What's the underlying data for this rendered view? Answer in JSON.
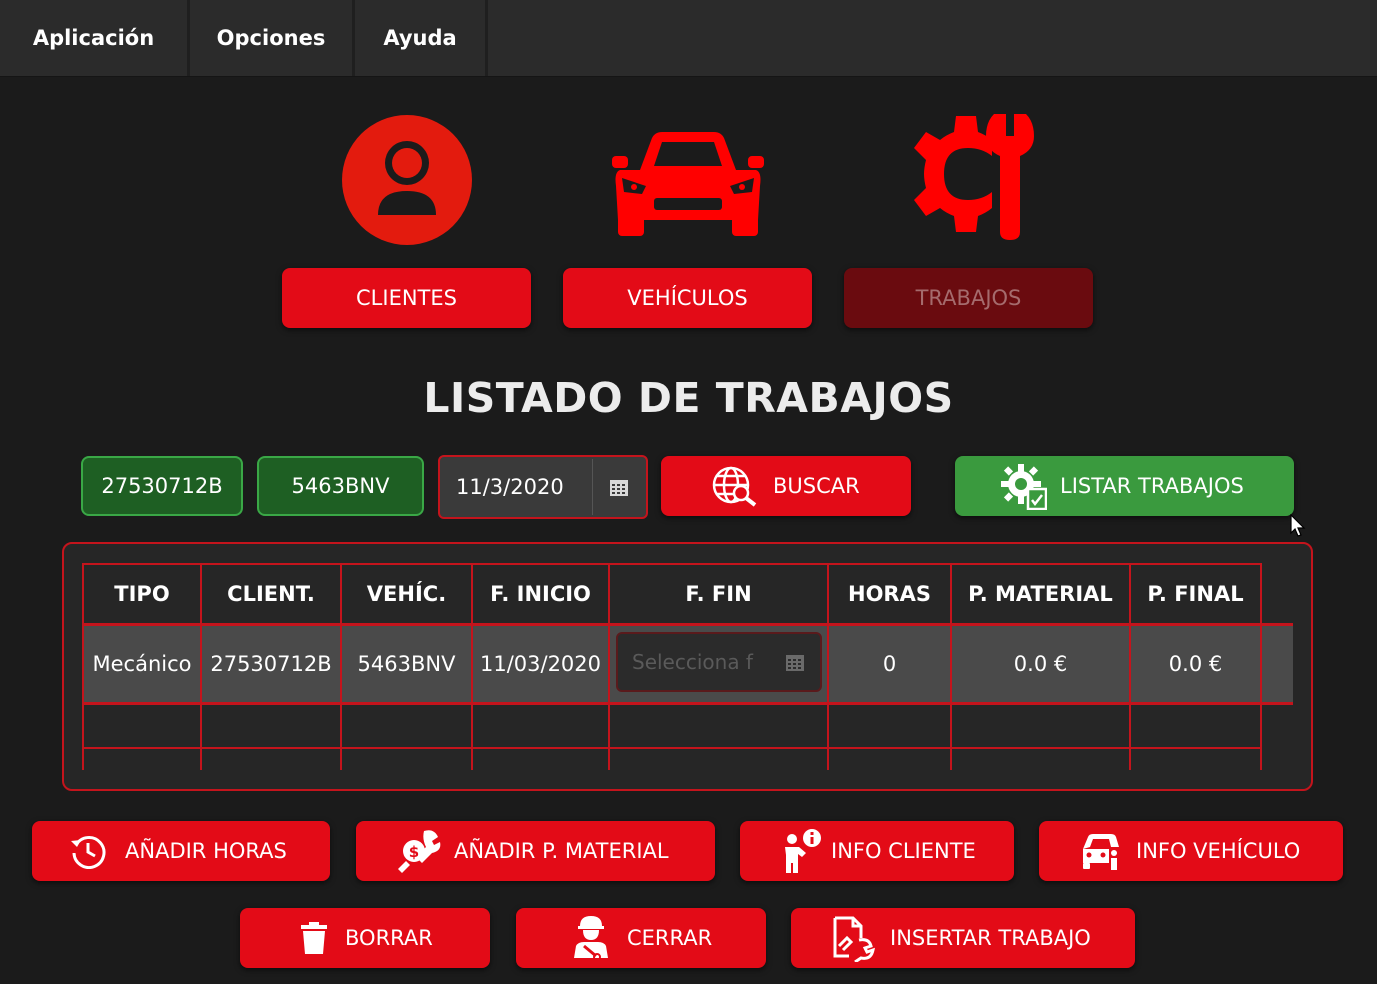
{
  "menu": {
    "items": [
      "Aplicación",
      "Opciones",
      "Ayuda"
    ]
  },
  "nav": {
    "clientes": "CLIENTES",
    "vehiculos": "VEHÍCULOS",
    "trabajos": "TRABAJOS"
  },
  "title": "LISTADO DE TRABAJOS",
  "filters": {
    "dni": "27530712B",
    "matricula": "5463BNV",
    "fecha": "11/3/2020",
    "buscar": "BUSCAR",
    "listar": "LISTAR TRABAJOS"
  },
  "table": {
    "headers": [
      "TIPO",
      "CLIENT.",
      "VEHÍC.",
      "F. INICIO",
      "F. FIN",
      "HORAS",
      "P. MATERIAL",
      "P. FINAL"
    ],
    "rows": [
      {
        "tipo": "Mecánico",
        "cliente": "27530712B",
        "vehiculo": "5463BNV",
        "inicio": "11/03/2020",
        "fin_placeholder": "Selecciona f",
        "horas": "0",
        "p_material": "0.0 €",
        "p_final": "0.0 €"
      }
    ]
  },
  "actions": {
    "anadir_horas": "AÑADIR HORAS",
    "anadir_material": "AÑADIR P. MATERIAL",
    "info_cliente": "INFO CLIENTE",
    "info_vehiculo": "INFO VEHÍCULO",
    "borrar": "BORRAR",
    "cerrar": "CERRAR",
    "insertar": "INSERTAR TRABAJO"
  },
  "colors": {
    "accent_red": "#e30b17",
    "green": "#3a9a3e",
    "background": "#1b1b1b"
  }
}
